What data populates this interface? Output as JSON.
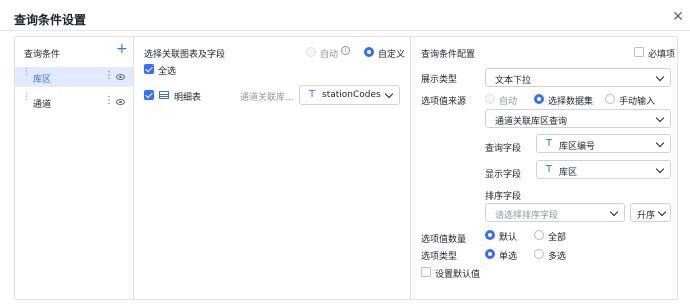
{
  "dialog": {
    "title": "查询条件设置",
    "close_icon": "close-icon"
  },
  "left": {
    "header": "查询条件",
    "add_icon": "+",
    "items": [
      {
        "label": "库区",
        "selected": true
      },
      {
        "label": "通道",
        "selected": false
      }
    ]
  },
  "middle": {
    "header": "选择关联图表及字段",
    "mode_auto": "自动",
    "mode_custom": "自定义",
    "select_all": "全选",
    "table_name": "明细表",
    "relation_text": "通道关联库...",
    "field_value": "stationCodes"
  },
  "right": {
    "header": "查询条件配置",
    "required_label": "必填项",
    "display_type_label": "展示类型",
    "display_type_value": "文本下拉",
    "source_label": "选项值来源",
    "source_auto": "自动",
    "source_dataset": "选择数据集",
    "source_manual": "手动输入",
    "dataset_value": "通道关联库区查询",
    "query_field_label": "查询字段",
    "query_field_value": "库区编号",
    "display_field_label": "显示字段",
    "display_field_value": "库区",
    "sort_field_label": "排序字段",
    "sort_field_placeholder": "请选择排序字段",
    "sort_order_value": "升序",
    "count_label": "选项值数量",
    "count_default": "默认",
    "count_all": "全部",
    "option_type_label": "选项类型",
    "option_single": "单选",
    "option_multi": "多选",
    "default_value_label": "设置默认值"
  },
  "colors": {
    "accent": "#3370ff",
    "selected_bg": "#e1eaff",
    "border": "#dee0e3"
  }
}
